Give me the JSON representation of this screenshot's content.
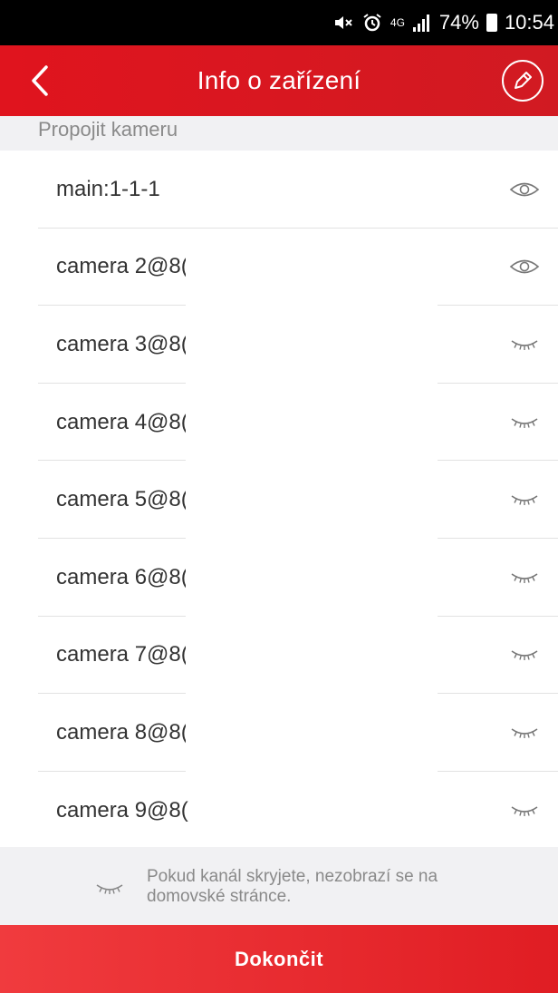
{
  "status_bar": {
    "network_type": "4G",
    "battery": "74%",
    "time": "10:54",
    "icons": [
      "mute-icon",
      "alarm-icon",
      "4g-icon",
      "signal-icon",
      "battery-icon"
    ]
  },
  "header": {
    "title": "Info o zařízení",
    "back_icon": "chevron-left-icon",
    "edit_icon": "pencil-icon"
  },
  "section": {
    "label": "Propojit kameru"
  },
  "cameras": [
    {
      "name": "main:1-1-1",
      "visibility": "visible"
    },
    {
      "name": "camera 2@8(",
      "visibility": "visible"
    },
    {
      "name": "camera 3@8(",
      "visibility": "hidden"
    },
    {
      "name": "camera 4@8(",
      "visibility": "hidden"
    },
    {
      "name": "camera 5@8(",
      "visibility": "hidden"
    },
    {
      "name": "camera 6@8(",
      "visibility": "hidden"
    },
    {
      "name": "camera 7@8(",
      "visibility": "hidden"
    },
    {
      "name": "camera 8@8(",
      "visibility": "hidden"
    },
    {
      "name": "camera 9@8(",
      "visibility": "hidden"
    }
  ],
  "hint": {
    "text": "Pokud kanál skryjete, nezobrazí se na domovské stránce."
  },
  "footer": {
    "finish_label": "Dokončit"
  },
  "colors": {
    "primary": "#E0141E",
    "button": "#EE3236",
    "text": "#333333",
    "muted": "#8A8A8A",
    "section_bg": "#F1F1F3"
  }
}
